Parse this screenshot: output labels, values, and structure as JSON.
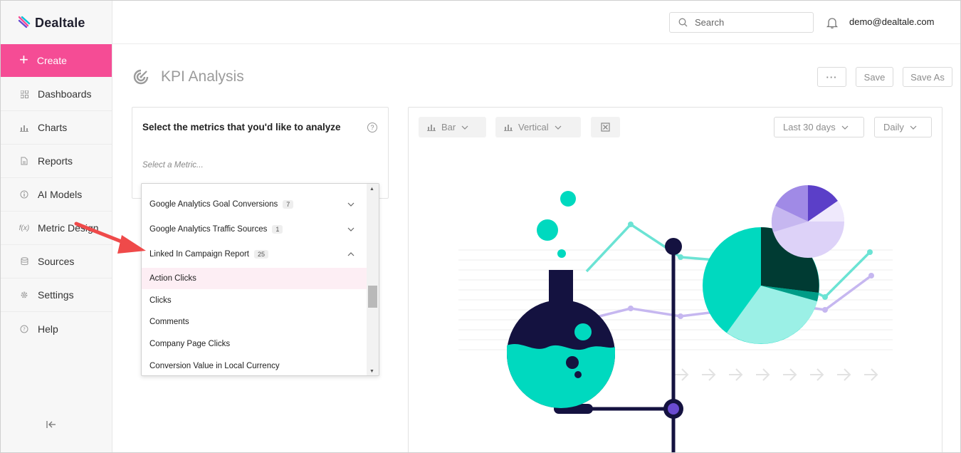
{
  "app": {
    "name": "Dealtale"
  },
  "sidebar": {
    "create_label": "Create",
    "items": [
      {
        "label": "Dashboards",
        "icon": "grid-icon"
      },
      {
        "label": "Charts",
        "icon": "bar-chart-icon"
      },
      {
        "label": "Reports",
        "icon": "document-icon"
      },
      {
        "label": "AI Models",
        "icon": "info-circle-icon"
      },
      {
        "label": "Metric Design",
        "icon": "function-icon"
      },
      {
        "label": "Sources",
        "icon": "database-icon"
      },
      {
        "label": "Settings",
        "icon": "gear-icon"
      },
      {
        "label": "Help",
        "icon": "help-circle-icon"
      }
    ],
    "collapse_icon": "collapse-left-icon"
  },
  "topbar": {
    "search_placeholder": "Search",
    "user_email": "demo@dealtale.com"
  },
  "page": {
    "title": "KPI Analysis",
    "more_label": "···",
    "save_label": "Save",
    "save_as_label": "Save As"
  },
  "metrics_panel": {
    "heading": "Select the metrics that you'd like to analyze",
    "help_glyph": "?",
    "placeholder": "Select a Metric..."
  },
  "dropdown": {
    "groups": [
      {
        "label": "Google Analytics Goal Conversions",
        "count": "7",
        "expanded": false
      },
      {
        "label": "Google Analytics Traffic Sources",
        "count": "1",
        "expanded": false
      },
      {
        "label": "Linked In Campaign Report",
        "count": "25",
        "expanded": true
      }
    ],
    "items": [
      {
        "label": "Action Clicks",
        "highlighted": true
      },
      {
        "label": "Clicks",
        "highlighted": false
      },
      {
        "label": "Comments",
        "highlighted": false
      },
      {
        "label": "Company Page Clicks",
        "highlighted": false
      },
      {
        "label": "Conversion Value in Local Currency",
        "highlighted": false
      }
    ]
  },
  "chart_toolbar": {
    "chart_type": "Bar",
    "orientation": "Vertical",
    "date_range": "Last 30 days",
    "granularity": "Daily"
  },
  "colors": {
    "accent": "#f54c95",
    "teal": "#00d9bf",
    "navy": "#141240",
    "lavender": "#c7b8f0",
    "purple": "#6a4bd1"
  }
}
